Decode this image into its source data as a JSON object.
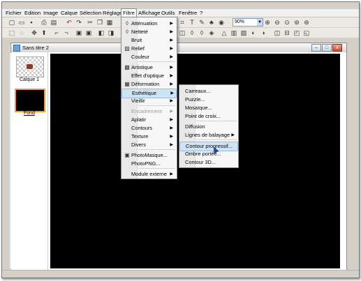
{
  "menubar": {
    "items": [
      "Fichier",
      "Edition",
      "Image",
      "Calque",
      "Sélection",
      "Réglage",
      "Filtre",
      "Affichage",
      "Outils",
      "Fenêtre",
      "?"
    ],
    "active": "Filtre"
  },
  "toolbar": {
    "zoom_value": "90%"
  },
  "document": {
    "title": "Sans titre 2",
    "layers": [
      {
        "label": "Calque 1"
      },
      {
        "label": "Fond"
      }
    ]
  },
  "filtre_menu": {
    "items": [
      {
        "label": "Atténuation",
        "icon": "blur-drop-icon",
        "submenu": true,
        "disabled": false
      },
      {
        "label": "Netteté",
        "icon": "sharpen-drop-icon",
        "submenu": true,
        "disabled": false
      },
      {
        "label": "Bruit",
        "icon": "",
        "submenu": true,
        "disabled": false
      },
      {
        "label": "Relief",
        "icon": "relief-icon",
        "submenu": true,
        "disabled": false
      },
      {
        "label": "Couleur",
        "icon": "",
        "submenu": true,
        "disabled": false
      },
      {
        "label": "Artistique",
        "icon": "palette-icon",
        "submenu": true,
        "disabled": false
      },
      {
        "label": "Effet d'optique",
        "icon": "",
        "submenu": true,
        "disabled": false
      },
      {
        "label": "Déformation",
        "icon": "grid-icon",
        "submenu": true,
        "disabled": false
      },
      {
        "label": "Esthétique",
        "icon": "",
        "submenu": true,
        "disabled": false,
        "highlighted": true
      },
      {
        "label": "Vieillir",
        "icon": "",
        "submenu": true,
        "disabled": false
      },
      {
        "label": "Encadrement",
        "icon": "",
        "submenu": true,
        "disabled": true
      },
      {
        "label": "Aplatir",
        "icon": "",
        "submenu": true,
        "disabled": false
      },
      {
        "label": "Contours",
        "icon": "",
        "submenu": true,
        "disabled": false
      },
      {
        "label": "Texture",
        "icon": "",
        "submenu": true,
        "disabled": false
      },
      {
        "label": "Divers",
        "icon": "",
        "submenu": true,
        "disabled": false
      },
      {
        "label": "PhotoMasque...",
        "icon": "photomask-icon",
        "submenu": false,
        "disabled": false
      },
      {
        "label": "PhotoPNG...",
        "icon": "",
        "submenu": false,
        "disabled": false
      },
      {
        "label": "Module externe",
        "icon": "",
        "submenu": true,
        "disabled": false
      }
    ]
  },
  "esthetique_menu": {
    "items": [
      {
        "label": "Carreaux...",
        "submenu": false
      },
      {
        "label": "Puzzle...",
        "submenu": false
      },
      {
        "label": "Mosaïque...",
        "submenu": false
      },
      {
        "label": "Point de croix...",
        "submenu": false
      },
      {
        "label": "Diffusion",
        "submenu": false
      },
      {
        "label": "Lignes de balayage",
        "submenu": true
      },
      {
        "label": "Contour progressif...",
        "submenu": false,
        "highlighted": true
      },
      {
        "label": "Ombre portée...",
        "submenu": false
      },
      {
        "label": "Contour 3D...",
        "submenu": false
      }
    ]
  },
  "colors": {
    "canvas": "#000000",
    "highlight": "#cfe3f7",
    "layer_selection": "#f19a2b"
  }
}
